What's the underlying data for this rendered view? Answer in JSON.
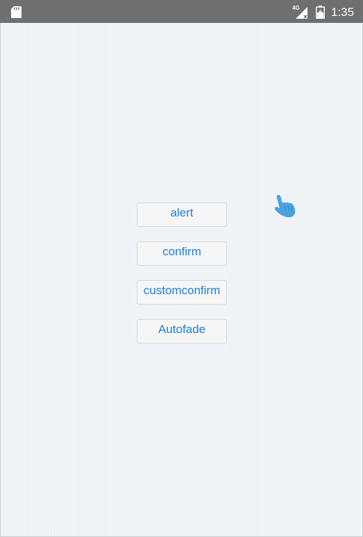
{
  "status_bar": {
    "network": "4G",
    "time": "1:35",
    "icons": [
      "sd-card-icon",
      "signal-icon",
      "battery-charging-icon"
    ]
  },
  "buttons": {
    "alert": "alert",
    "confirm": "confirm",
    "customconfirm": "customconfirm",
    "autofade": "Autofade"
  },
  "colors": {
    "status_bar": "#6f6f6f",
    "button_text": "#1e7fd9",
    "button_bg": "#f6f6f6",
    "page_bg": "#eef3f7",
    "pointer": "#4aa3df"
  },
  "pointer_icon": "hand-pointer-icon"
}
